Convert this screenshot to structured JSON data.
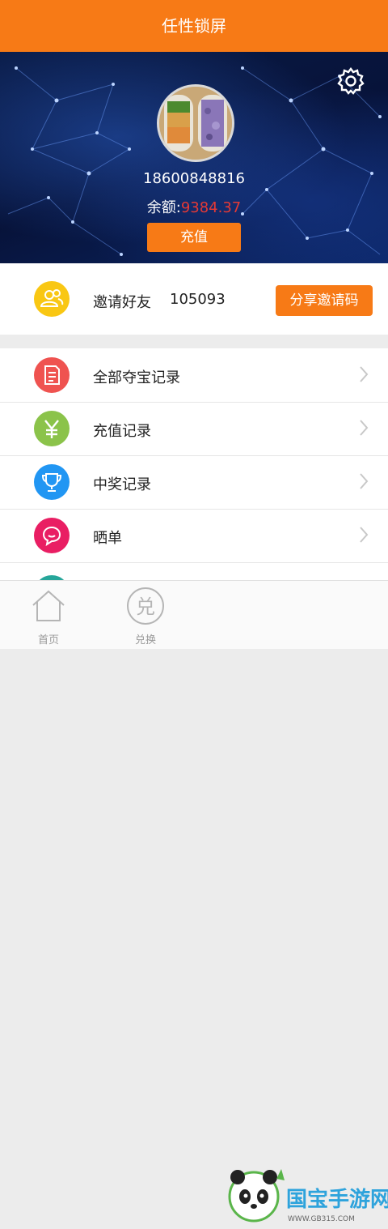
{
  "header": {
    "title": "任性锁屏"
  },
  "profile": {
    "phone": "18600848816",
    "balance_label": "余额:",
    "balance_value": "9384.37",
    "recharge_label": "充值"
  },
  "invite": {
    "label": "邀请好友",
    "code": "105093",
    "share_label": "分享邀请码"
  },
  "menu": {
    "items": [
      {
        "label": "全部夺宝记录",
        "icon": "document-icon",
        "color": "#ef5350"
      },
      {
        "label": "充值记录",
        "icon": "yen-icon",
        "color": "#8bc34a"
      },
      {
        "label": "中奖记录",
        "icon": "trophy-icon",
        "color": "#2196f3"
      },
      {
        "label": "晒单",
        "icon": "chat-icon",
        "color": "#e91e63"
      }
    ]
  },
  "tabbar": {
    "tabs": [
      {
        "label": "首页",
        "icon": "home-icon"
      },
      {
        "label": "兑换",
        "icon": "exchange-icon",
        "glyph": "兑"
      }
    ]
  },
  "watermark": {
    "text": "国宝手游网",
    "url": "WWW.GB315.COM"
  },
  "colors": {
    "accent": "#f77a16",
    "balance": "#e53935"
  }
}
